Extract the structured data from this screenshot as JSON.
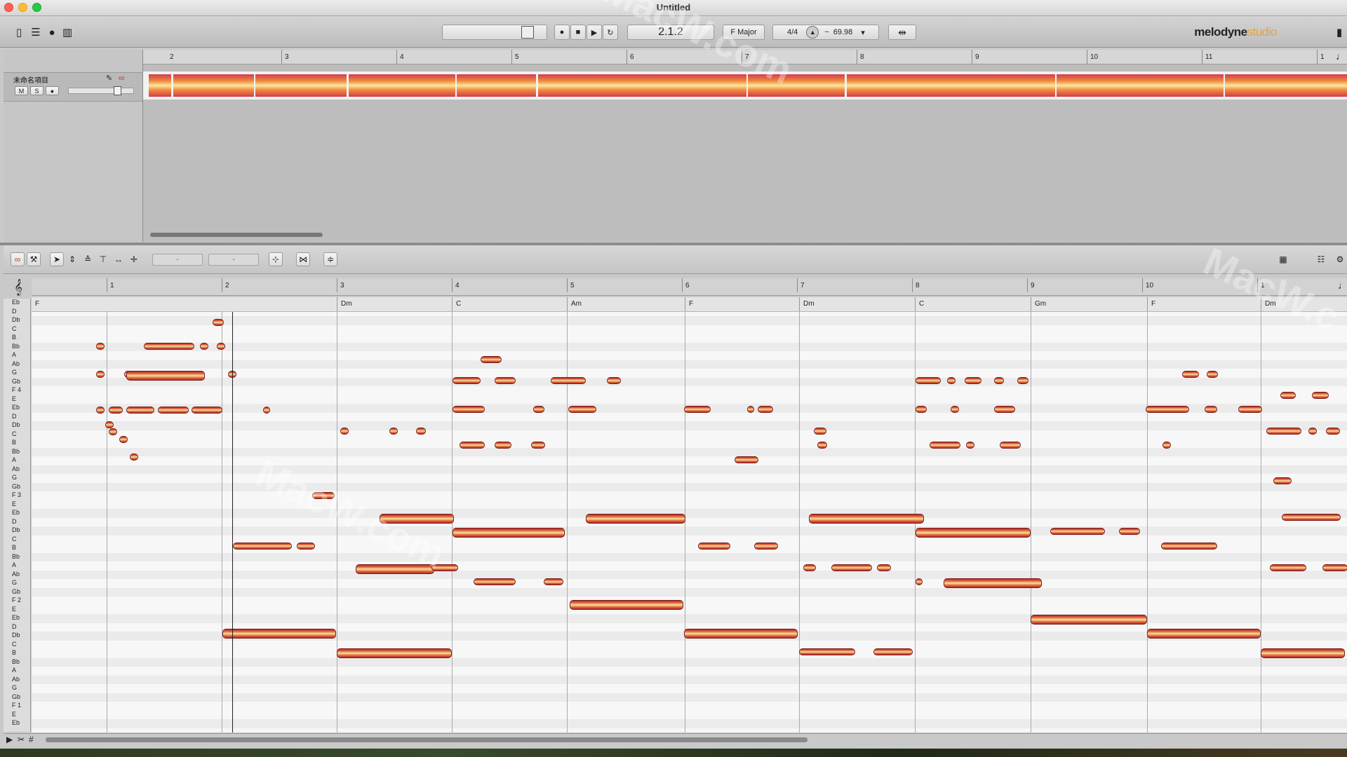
{
  "window": {
    "title": "Untitled"
  },
  "toolbar": {
    "position": "2.1.2",
    "key": "F Major",
    "time_signature": "4/4",
    "tempo": "69.98",
    "tempo_prefix": "~",
    "brand_main": "melodyne",
    "brand_sub": "studio",
    "icons": [
      "layout-icon",
      "mixer-icon",
      "blobs-icon",
      "spectrum-icon",
      "record-icon",
      "stop-icon",
      "play-icon",
      "loop-icon",
      "tempo-detect-icon",
      "metronome-icon",
      "sidebar-icon"
    ]
  },
  "track": {
    "name": "未命名項目",
    "mute_label": "M",
    "solo_label": "S",
    "record_label": "●"
  },
  "upper_ruler": {
    "bars": [
      "2",
      "3",
      "4",
      "5",
      "6",
      "7",
      "8",
      "9",
      "10",
      "11",
      "1"
    ]
  },
  "editor_toolbar": {
    "field1": "-",
    "field2": "-",
    "icons": [
      "link-icon",
      "wrench-icon",
      "pointer-tool-icon",
      "pitch-tool-icon",
      "formant-tool-icon",
      "amplitude-tool-icon",
      "timing-tool-icon",
      "separation-tool-icon",
      "quantize-pitch-icon",
      "quantize-time-icon",
      "pitch-center-icon",
      "view-icon",
      "list-icon",
      "gear-icon"
    ]
  },
  "editor_ruler": {
    "bars": [
      "1",
      "2",
      "3",
      "4",
      "5",
      "6",
      "7",
      "8",
      "9",
      "10",
      "1"
    ]
  },
  "chords": [
    "F",
    "Dm",
    "C",
    "Am",
    "F",
    "Dm",
    "C",
    "Gm",
    "F",
    "Dm"
  ],
  "pitch_labels": [
    "Eb",
    "D",
    "Db",
    "C",
    "B",
    "Bb",
    "A",
    "Ab",
    "G",
    "Gb",
    "F 4",
    "E",
    "Eb",
    "D",
    "Db",
    "C",
    "B",
    "Bb",
    "A",
    "Ab",
    "G",
    "Gb",
    "F 3",
    "E",
    "Eb",
    "D",
    "Db",
    "C",
    "B",
    "Bb",
    "A",
    "Ab",
    "G",
    "Gb",
    "F 2",
    "E",
    "Eb",
    "D",
    "Db",
    "C",
    "B",
    "Bb",
    "A",
    "Ab",
    "G",
    "Gb",
    "F 1",
    "E",
    "Eb"
  ],
  "watermarks": [
    "MacW.com",
    "MacW.com",
    "MacW.c"
  ]
}
